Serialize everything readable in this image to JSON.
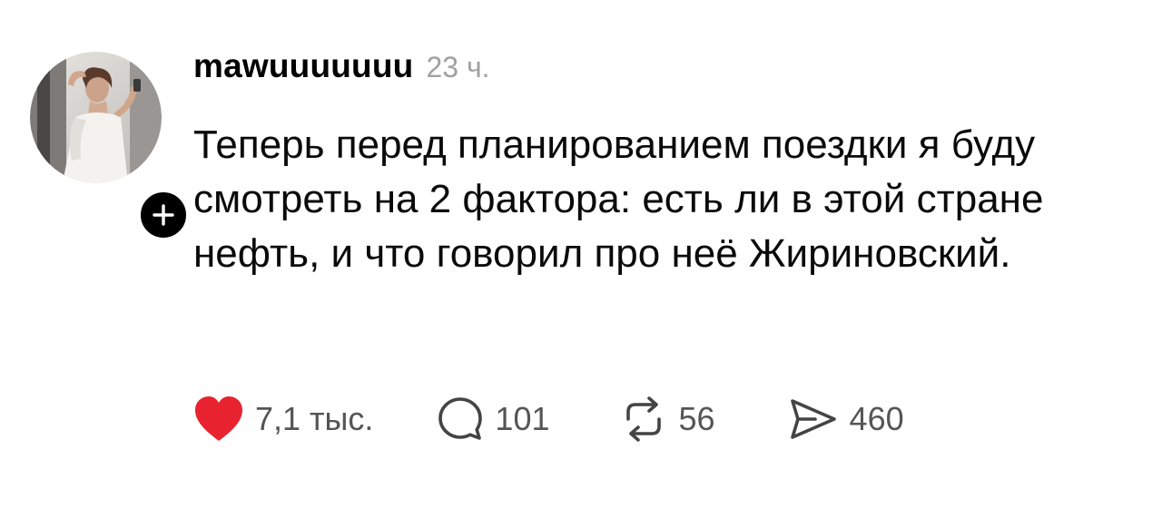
{
  "post": {
    "username": "mawuuuuuuu",
    "time": "23 ч.",
    "text": "Теперь перед планированием поездки я буду смотреть на 2 фактора: есть ли в этой стране нефть, и что говорил про неё Жириновский."
  },
  "actions": {
    "likes": "7,1 тыс.",
    "comments": "101",
    "reposts": "56",
    "shares": "460"
  },
  "icons": {
    "like": "heart-icon",
    "comment": "comment-bubble-icon",
    "repost": "repost-arrows-icon",
    "share": "send-paper-plane-icon",
    "follow": "plus-icon"
  },
  "colors": {
    "like_active": "#e8232f",
    "muted_text": "#a0a0a0",
    "icon_gray": "#555555"
  }
}
